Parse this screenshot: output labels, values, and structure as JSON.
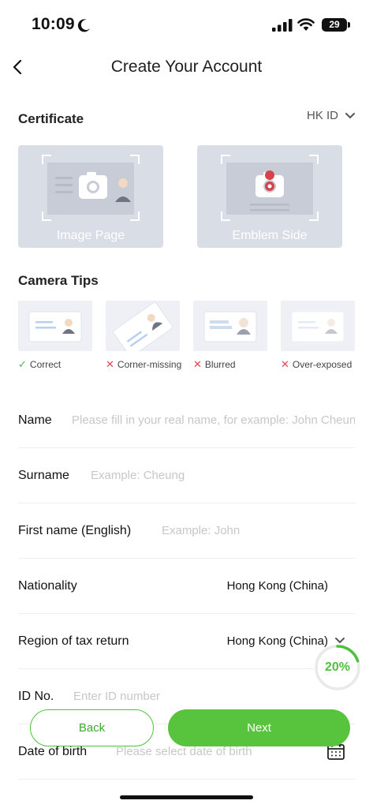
{
  "status_bar": {
    "time": "10:09",
    "battery": "29"
  },
  "header": {
    "title": "Create Your Account"
  },
  "certificate": {
    "title": "Certificate",
    "selected_type": "HK ID",
    "cards": [
      {
        "label": "Image Page"
      },
      {
        "label": "Emblem Side"
      }
    ]
  },
  "camera_tips": {
    "title": "Camera Tips",
    "tips": [
      {
        "label": "Correct",
        "status": "ok"
      },
      {
        "label": "Corner-missing",
        "status": "bad"
      },
      {
        "label": "Blurred",
        "status": "bad"
      },
      {
        "label": "Over-exposed",
        "status": "bad"
      }
    ]
  },
  "form": {
    "name": {
      "label": "Name",
      "placeholder": "Please fill in your real name, for example: John Cheung"
    },
    "surname": {
      "label": "Surname",
      "placeholder": "Example: Cheung"
    },
    "first_name": {
      "label": "First name (English)",
      "placeholder": "Example: John"
    },
    "nationality": {
      "label": "Nationality",
      "value": "Hong Kong (China)"
    },
    "tax_region": {
      "label": "Region of tax return",
      "value": "Hong Kong (China)"
    },
    "id_no": {
      "label": "ID No.",
      "placeholder": "Enter ID number"
    },
    "dob": {
      "label": "Date of birth",
      "placeholder": "Please select date of birth"
    }
  },
  "progress": {
    "text": "20%",
    "value": 0.2,
    "color": "#4fbf3f"
  },
  "actions": {
    "back_label": "Back",
    "next_label": "Next"
  },
  "colors": {
    "accent": "#58c43e",
    "error": "#e0474c"
  }
}
